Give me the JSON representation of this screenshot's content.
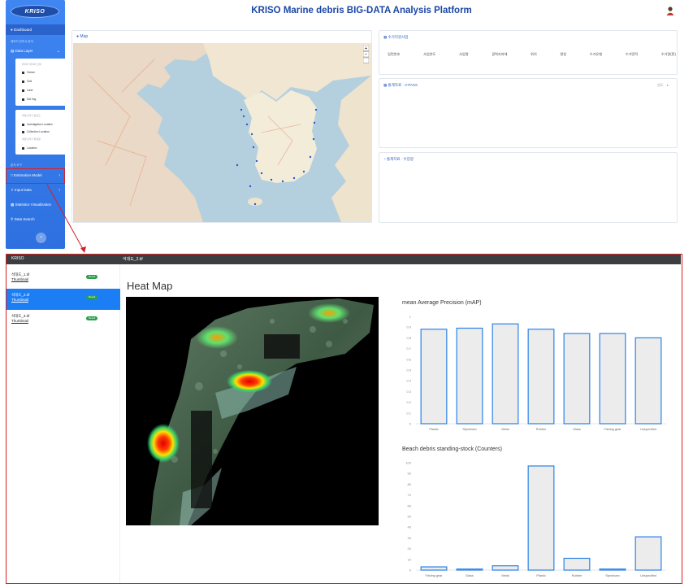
{
  "header": {
    "title": "KRISO Marine debris BIG-DATA Analysis Platform"
  },
  "sidebar": {
    "logo": "KRISO",
    "dashboard_label": "Dashboard",
    "section1": "데이터 관리 & 분석",
    "data_layer_label": "Data Layer",
    "layer_caption": "데이터 레이어 선택",
    "layers": [
      "Ocean",
      "Grid",
      "Land",
      "Sat Img"
    ],
    "group_caption1": "해양쓰레기 분포도",
    "group_rows1": [
      "Investigation Location",
      "Collection Location"
    ],
    "group_caption2": "해양쓰레기 발생원",
    "group_rows2": [
      "Location"
    ],
    "section2": "분석 도구",
    "nav": [
      "Estimation Model",
      "Input Data",
      "Statistics Visualization",
      "Data Search"
    ]
  },
  "map": {
    "title": "Map"
  },
  "panel1": {
    "title": "수거지원사업",
    "columns": [
      "일련번호",
      "사업연도",
      "사업명",
      "광역지자체",
      "위치",
      "명칭",
      "수거유형",
      "수거면적",
      "수거량(톤)"
    ]
  },
  "panel2": {
    "title": "통계자료 · V-PASS",
    "tool": "연도"
  },
  "panel3": {
    "title": "통계자료 · 수집량"
  },
  "detail": {
    "bar_left": "KRISO",
    "bar_right": "석대도_2.tif",
    "files": [
      {
        "name": "석대도_1.tif",
        "link": "Thumbnail",
        "badge": "Result"
      },
      {
        "name": "석대도_2.tif",
        "link": "Thumbnail",
        "badge": "Result"
      },
      {
        "name": "석대도_3.tif",
        "link": "Thumbnail",
        "badge": "Result"
      }
    ],
    "heatmap_title": "Heat Map"
  },
  "chart_data": [
    {
      "type": "bar",
      "title": "mean Average Precision (mAP)",
      "categories": [
        "Plastic",
        "Styrofoam",
        "Metal",
        "Rubber",
        "Glass",
        "Fishing gear",
        "Unspecified"
      ],
      "values": [
        0.88,
        0.89,
        0.93,
        0.88,
        0.84,
        0.84,
        0.8
      ],
      "ylim": [
        0,
        1
      ],
      "yticks": [
        "0",
        "0.1",
        "0.2",
        "0.3",
        "0.4",
        "0.5",
        "0.6",
        "0.7",
        "0.8",
        "0.9",
        "1"
      ],
      "grid": false
    },
    {
      "type": "bar",
      "title": "Beach debris standing-stock (Counters)",
      "categories": [
        "Fishing gear",
        "Glass",
        "Metal",
        "Plastic",
        "Rubber",
        "Styrofoam",
        "Unspecified"
      ],
      "values": [
        3,
        1,
        4,
        97,
        11,
        1,
        31
      ],
      "ylim": [
        0,
        100
      ],
      "yticks": [
        "0",
        "10",
        "20",
        "30",
        "40",
        "50",
        "60",
        "70",
        "80",
        "90",
        "100"
      ],
      "grid": false
    }
  ],
  "colors": {
    "sidebar": "#2e70e0",
    "accent": "#1c7ef4",
    "bar_stroke": "#2a82e6",
    "bar_fill": "#ececec",
    "highlight": "#d42020"
  }
}
